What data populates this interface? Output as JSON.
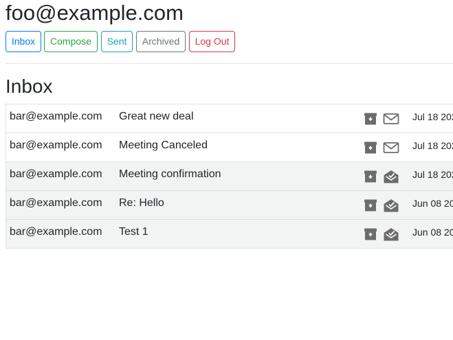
{
  "user": {
    "email": "foo@example.com"
  },
  "nav": {
    "buttons": [
      {
        "label": "Inbox",
        "color": "#007bff"
      },
      {
        "label": "Compose",
        "color": "#28a745"
      },
      {
        "label": "Sent",
        "color": "#17a2b8"
      },
      {
        "label": "Archived",
        "color": "#6c757d"
      },
      {
        "label": "Log Out",
        "color": "#dc3545"
      }
    ]
  },
  "mailbox": {
    "title": "Inbox",
    "emails": [
      {
        "from": "bar@example.com",
        "subject": "Great new deal",
        "date": "Jul 18 202",
        "read": false,
        "archive_icon": "archive-icon",
        "status_icon": "envelope-closed-icon"
      },
      {
        "from": "bar@example.com",
        "subject": "Meeting Canceled",
        "date": "Jul 18 202",
        "read": false,
        "archive_icon": "archive-icon",
        "status_icon": "envelope-closed-icon"
      },
      {
        "from": "bar@example.com",
        "subject": "Meeting confirmation",
        "date": "Jul 18 202",
        "read": true,
        "archive_icon": "archive-icon",
        "status_icon": "envelope-open-icon"
      },
      {
        "from": "bar@example.com",
        "subject": "Re: Hello",
        "date": "Jun 08 20",
        "read": true,
        "archive_icon": "archive-icon",
        "status_icon": "envelope-open-icon"
      },
      {
        "from": "bar@example.com",
        "subject": "Test 1",
        "date": "Jun 08 20",
        "read": true,
        "archive_icon": "archive-icon",
        "status_icon": "envelope-open-icon"
      }
    ]
  },
  "colors": {
    "icon_gray": "#6c6c6c",
    "read_row_background": "#f2f3f3",
    "unread_row_background": "#ffffff"
  }
}
